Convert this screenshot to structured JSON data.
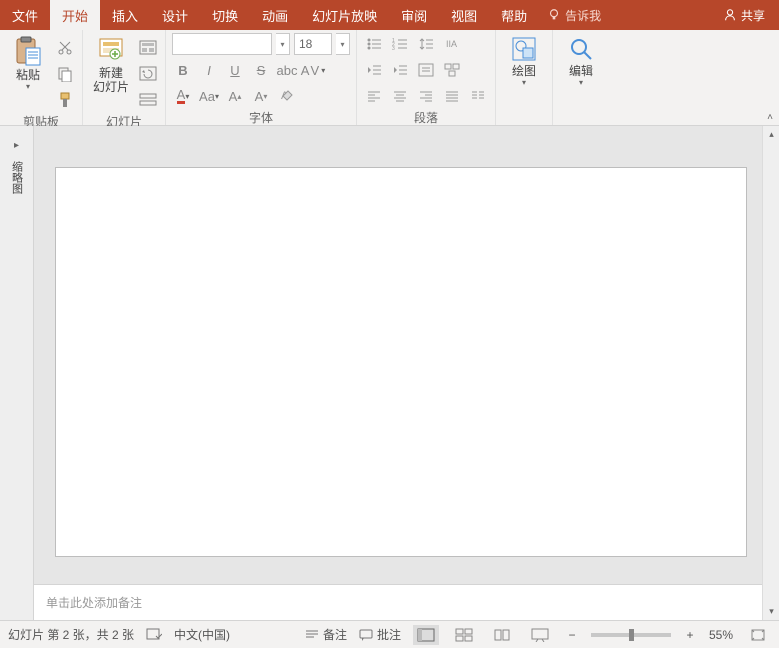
{
  "tabs": {
    "file": "文件",
    "home": "开始",
    "insert": "插入",
    "design": "设计",
    "transition": "切换",
    "animation": "动画",
    "slideshow": "幻灯片放映",
    "review": "审阅",
    "view": "视图",
    "help": "帮助",
    "tellme": "告诉我",
    "share": "共享"
  },
  "ribbon": {
    "clipboard": {
      "paste": "粘贴",
      "label": "剪贴板"
    },
    "slides": {
      "newslide1": "新建",
      "newslide2": "幻灯片",
      "label": "幻灯片"
    },
    "font": {
      "size": "18",
      "label": "字体"
    },
    "paragraph": {
      "label": "段落"
    },
    "drawing": {
      "draw": "绘图",
      "label": ""
    },
    "editing": {
      "edit": "编辑",
      "label": ""
    }
  },
  "side": {
    "thumbnails": "缩略图"
  },
  "notes": {
    "placeholder": "单击此处添加备注"
  },
  "status": {
    "slideinfo": "幻灯片 第 2 张，共 2 张",
    "lang": "中文(中国)",
    "notes": "备注",
    "comments": "批注",
    "zoom": "55%"
  }
}
